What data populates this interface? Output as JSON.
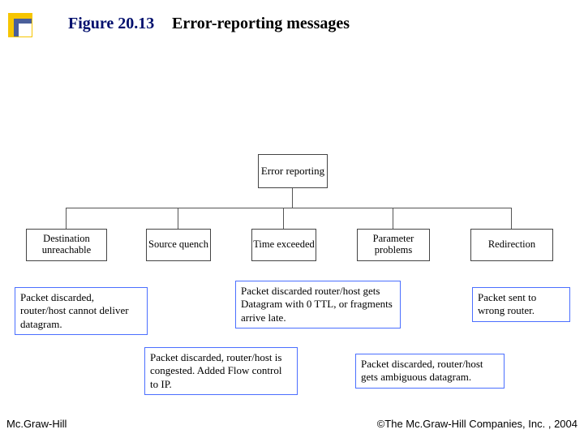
{
  "header": {
    "figure_ref": "Figure 20.13",
    "title": "Error-reporting messages"
  },
  "tree": {
    "root": "Error reporting",
    "leaves": [
      "Destination unreachable",
      "Source quench",
      "Time exceeded",
      "Parameter problems",
      "Redirection"
    ]
  },
  "annotations": {
    "a1": "Packet discarded, router/host cannot deliver datagram.",
    "a2": "Packet discarded, router/host is congested. Added Flow control to IP.",
    "a3": "Packet discarded router/host gets Datagram with 0 TTL, or fragments arrive late.",
    "a4": "Packet discarded, router/host gets ambiguous datagram.",
    "a5": "Packet sent to wrong router."
  },
  "footer": {
    "left": "Mc.Graw-Hill",
    "right": "©The Mc.Graw-Hill Companies, Inc. , 2004"
  }
}
